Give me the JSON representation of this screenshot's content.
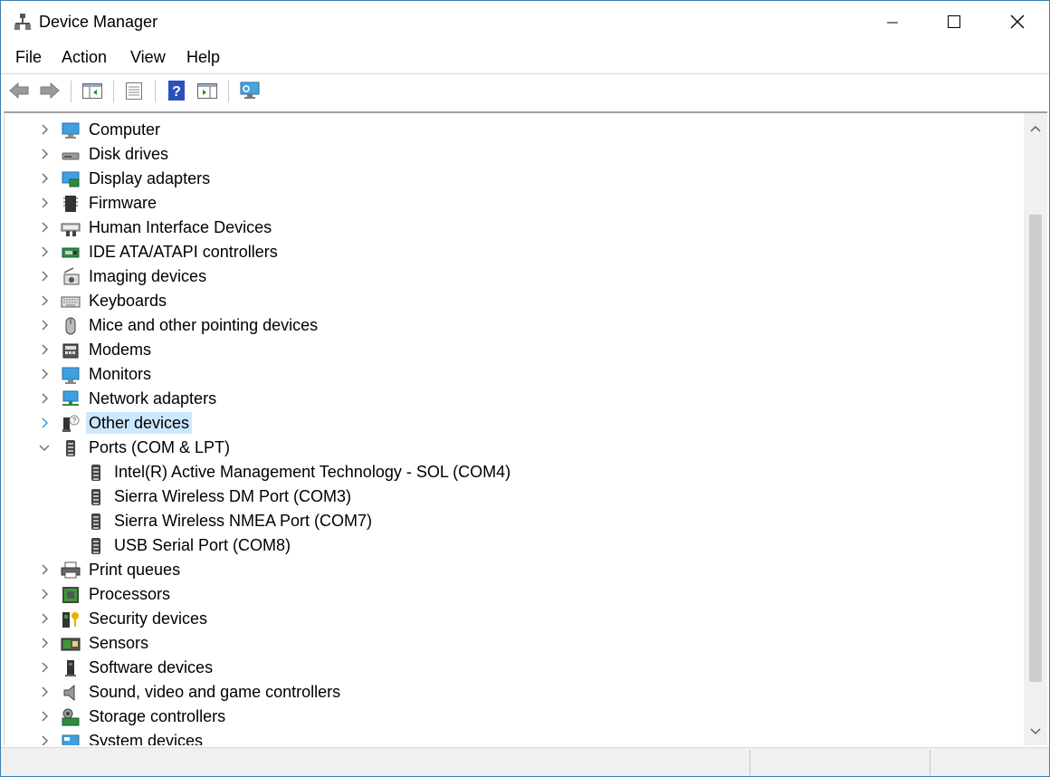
{
  "window": {
    "title": "Device Manager"
  },
  "menu": [
    "File",
    "Action",
    "View",
    "Help"
  ],
  "tree": [
    {
      "label": "Computer",
      "icon": "computer-icon",
      "level": 0,
      "expander": "collapsed"
    },
    {
      "label": "Disk drives",
      "icon": "disk-drive-icon",
      "level": 0,
      "expander": "collapsed"
    },
    {
      "label": "Display adapters",
      "icon": "display-adapter-icon",
      "level": 0,
      "expander": "collapsed"
    },
    {
      "label": "Firmware",
      "icon": "firmware-icon",
      "level": 0,
      "expander": "collapsed"
    },
    {
      "label": "Human Interface Devices",
      "icon": "hid-icon",
      "level": 0,
      "expander": "collapsed"
    },
    {
      "label": "IDE ATA/ATAPI controllers",
      "icon": "ide-controller-icon",
      "level": 0,
      "expander": "collapsed"
    },
    {
      "label": "Imaging devices",
      "icon": "imaging-device-icon",
      "level": 0,
      "expander": "collapsed"
    },
    {
      "label": "Keyboards",
      "icon": "keyboard-icon",
      "level": 0,
      "expander": "collapsed"
    },
    {
      "label": "Mice and other pointing devices",
      "icon": "mouse-icon",
      "level": 0,
      "expander": "collapsed"
    },
    {
      "label": "Modems",
      "icon": "modem-icon",
      "level": 0,
      "expander": "collapsed"
    },
    {
      "label": "Monitors",
      "icon": "monitor-icon",
      "level": 0,
      "expander": "collapsed"
    },
    {
      "label": "Network adapters",
      "icon": "network-adapter-icon",
      "level": 0,
      "expander": "collapsed"
    },
    {
      "label": "Other devices",
      "icon": "unknown-device-icon",
      "level": 0,
      "expander": "collapsed",
      "selected": true
    },
    {
      "label": "Ports (COM & LPT)",
      "icon": "port-icon",
      "level": 0,
      "expander": "expanded"
    },
    {
      "label": "Intel(R) Active Management Technology - SOL (COM4)",
      "icon": "port-icon",
      "level": 1,
      "expander": "none"
    },
    {
      "label": "Sierra Wireless DM Port (COM3)",
      "icon": "port-icon",
      "level": 1,
      "expander": "none"
    },
    {
      "label": "Sierra Wireless NMEA Port (COM7)",
      "icon": "port-icon",
      "level": 1,
      "expander": "none"
    },
    {
      "label": "USB Serial Port (COM8)",
      "icon": "port-icon",
      "level": 1,
      "expander": "none"
    },
    {
      "label": "Print queues",
      "icon": "printer-icon",
      "level": 0,
      "expander": "collapsed"
    },
    {
      "label": "Processors",
      "icon": "processor-icon",
      "level": 0,
      "expander": "collapsed"
    },
    {
      "label": "Security devices",
      "icon": "security-device-icon",
      "level": 0,
      "expander": "collapsed"
    },
    {
      "label": "Sensors",
      "icon": "sensor-icon",
      "level": 0,
      "expander": "collapsed"
    },
    {
      "label": "Software devices",
      "icon": "software-device-icon",
      "level": 0,
      "expander": "collapsed"
    },
    {
      "label": "Sound, video and game controllers",
      "icon": "speaker-icon",
      "level": 0,
      "expander": "collapsed"
    },
    {
      "label": "Storage controllers",
      "icon": "storage-controller-icon",
      "level": 0,
      "expander": "collapsed"
    },
    {
      "label": "System devices",
      "icon": "system-device-icon",
      "level": 0,
      "expander": "collapsed"
    }
  ],
  "colors": {
    "selection": "#cce8ff",
    "expander_hover": "#1e9bdc",
    "window_border": "#3c7fb1"
  }
}
